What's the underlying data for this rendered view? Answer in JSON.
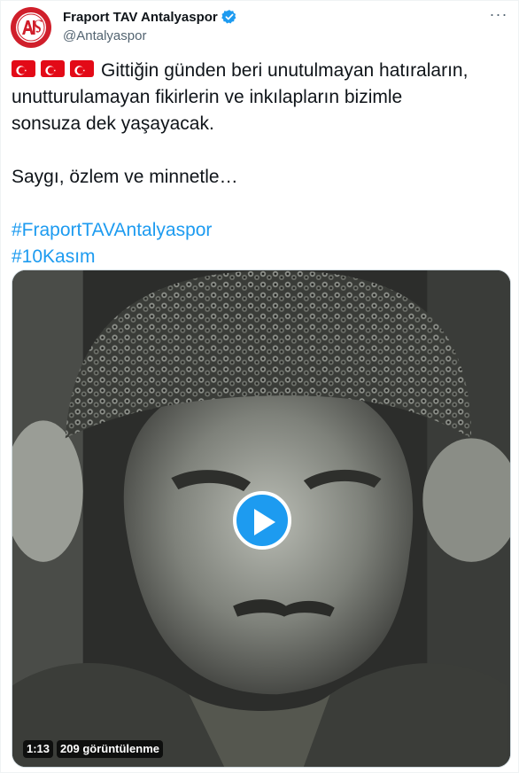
{
  "account": {
    "display_name": "Fraport TAV Antalyaspor",
    "handle": "@Antalyaspor",
    "avatar_text": "ANTALYASPOR",
    "verified": true
  },
  "more_menu_label": "···",
  "tweet": {
    "flags": [
      "turkey-flag",
      "turkey-flag",
      "turkey-flag"
    ],
    "line1": "Gittiğin günden beri unutulmayan hatıraların,",
    "line2": "unutturulamayan fikirlerin ve inkılapların bizimle",
    "line3": "sonsuza dek yaşayacak.",
    "line4": "Saygı, özlem ve minnetle…",
    "hashtags": [
      "#FraportTAVAntalyaspor",
      "#10Kasım"
    ]
  },
  "video": {
    "duration": "1:13",
    "views": "209 görüntülenme"
  },
  "colors": {
    "accent": "#1d9bf0",
    "club_red": "#d01f2b",
    "flag_red": "#e30a17"
  }
}
